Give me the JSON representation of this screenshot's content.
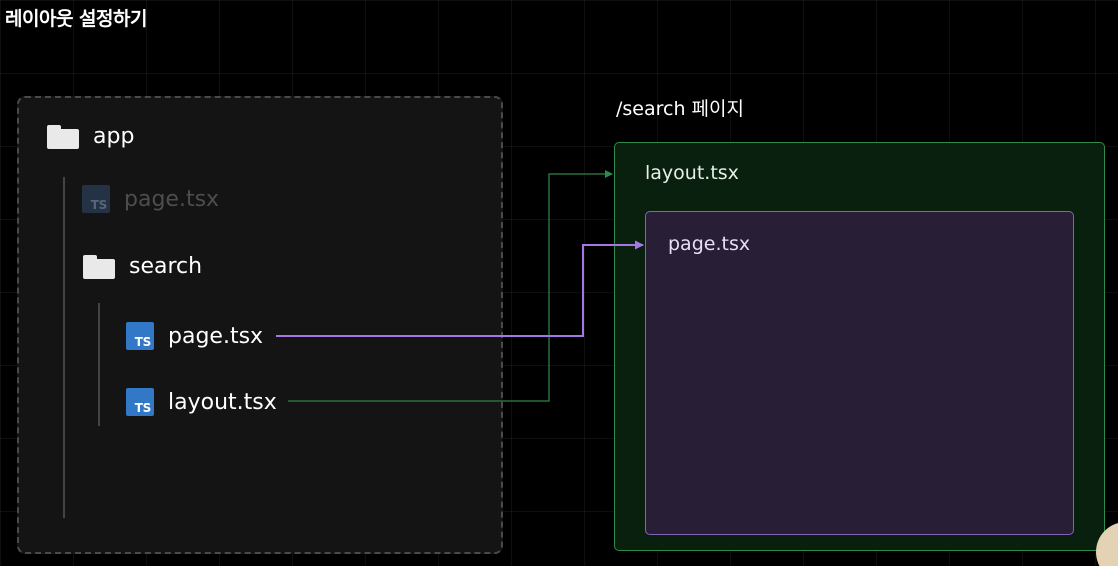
{
  "title": "레이아웃 설정하기",
  "tree": {
    "root": {
      "label": "app",
      "icon": "folder-icon"
    },
    "root_page": {
      "label": "page.tsx",
      "icon": "typescript-file-icon",
      "muted": true
    },
    "search_folder": {
      "label": "search",
      "icon": "folder-icon"
    },
    "search_page": {
      "label": "page.tsx",
      "icon": "typescript-file-icon"
    },
    "search_layout": {
      "label": "layout.tsx",
      "icon": "typescript-file-icon"
    },
    "ts_badge": "TS"
  },
  "diagram": {
    "heading": "/search 페이지",
    "layout_label": "layout.tsx",
    "page_label": "page.tsx"
  },
  "colors": {
    "layout_accent": "#2e8b4a",
    "page_accent": "#9a6fd6",
    "ts_blue": "#3178c6"
  }
}
